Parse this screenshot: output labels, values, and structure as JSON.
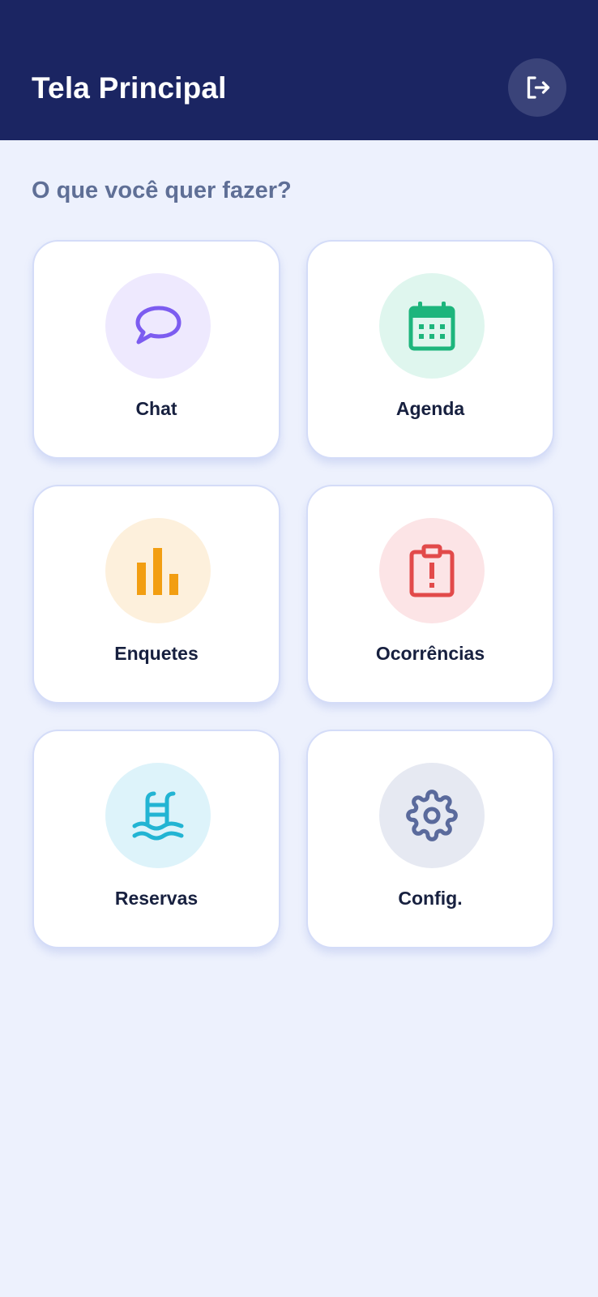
{
  "header": {
    "title": "Tela Principal",
    "logout_icon": "logout-icon",
    "background_color": "#1B2562"
  },
  "main": {
    "prompt": "O que você quer fazer?",
    "cards": [
      {
        "label": "Chat",
        "icon": "chat-bubble-icon",
        "icon_color": "#7C5CF0",
        "circle_color": "#EEE9FE"
      },
      {
        "label": "Agenda",
        "icon": "calendar-icon",
        "icon_color": "#1DB57C",
        "circle_color": "#DFF6EE"
      },
      {
        "label": "Enquetes",
        "icon": "bar-chart-icon",
        "icon_color": "#F29E12",
        "circle_color": "#FDF0DC"
      },
      {
        "label": "Ocorrências",
        "icon": "alert-clipboard-icon",
        "icon_color": "#E24A4A",
        "circle_color": "#FCE4E6"
      },
      {
        "label": "Reservas",
        "icon": "pool-icon",
        "icon_color": "#22B4D3",
        "circle_color": "#DDF3FA"
      },
      {
        "label": "Config.",
        "icon": "gear-icon",
        "icon_color": "#5A6A9C",
        "circle_color": "#E6E9F2"
      }
    ]
  }
}
